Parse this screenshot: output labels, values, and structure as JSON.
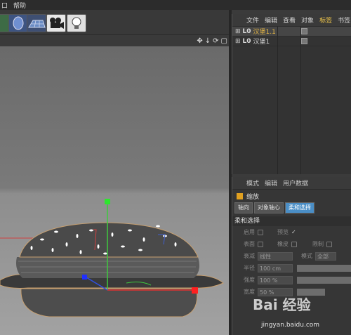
{
  "menubar": {
    "items": [
      "口",
      "帮助"
    ]
  },
  "viewport": {
    "nav_icons": [
      "✥",
      "↓",
      "⟳",
      "▢"
    ]
  },
  "object_manager": {
    "tabs": [
      "文件",
      "编辑",
      "查看",
      "对象",
      "标签",
      "书签"
    ],
    "active_tab": "标签",
    "objects": [
      {
        "layer": "L0",
        "name": "汉堡1.1"
      },
      {
        "layer": "L0",
        "name": "汉堡1"
      }
    ]
  },
  "attributes": {
    "tabs": [
      "模式",
      "编辑",
      "用户数据"
    ],
    "title": "缩放",
    "sub_tabs": [
      "轴向",
      "对象轴心",
      "柔和选择"
    ],
    "active_sub_tab": "柔和选择",
    "section": "柔和选择",
    "rows": [
      {
        "label": "启用",
        "label2": "预览",
        "check2": "✓"
      },
      {
        "label": "表面",
        "label2": "橡皮",
        "label3": "限制"
      },
      {
        "label": "衰减",
        "value": "线性",
        "label2": "模式",
        "value2": "全部"
      },
      {
        "label": "半径",
        "value": "100 cm"
      },
      {
        "label": "强度",
        "value": "100 %"
      },
      {
        "label": "宽度",
        "value": "50 %"
      }
    ]
  },
  "watermark": {
    "logo": "Bai 经验",
    "url": "jingyan.baidu.com"
  }
}
